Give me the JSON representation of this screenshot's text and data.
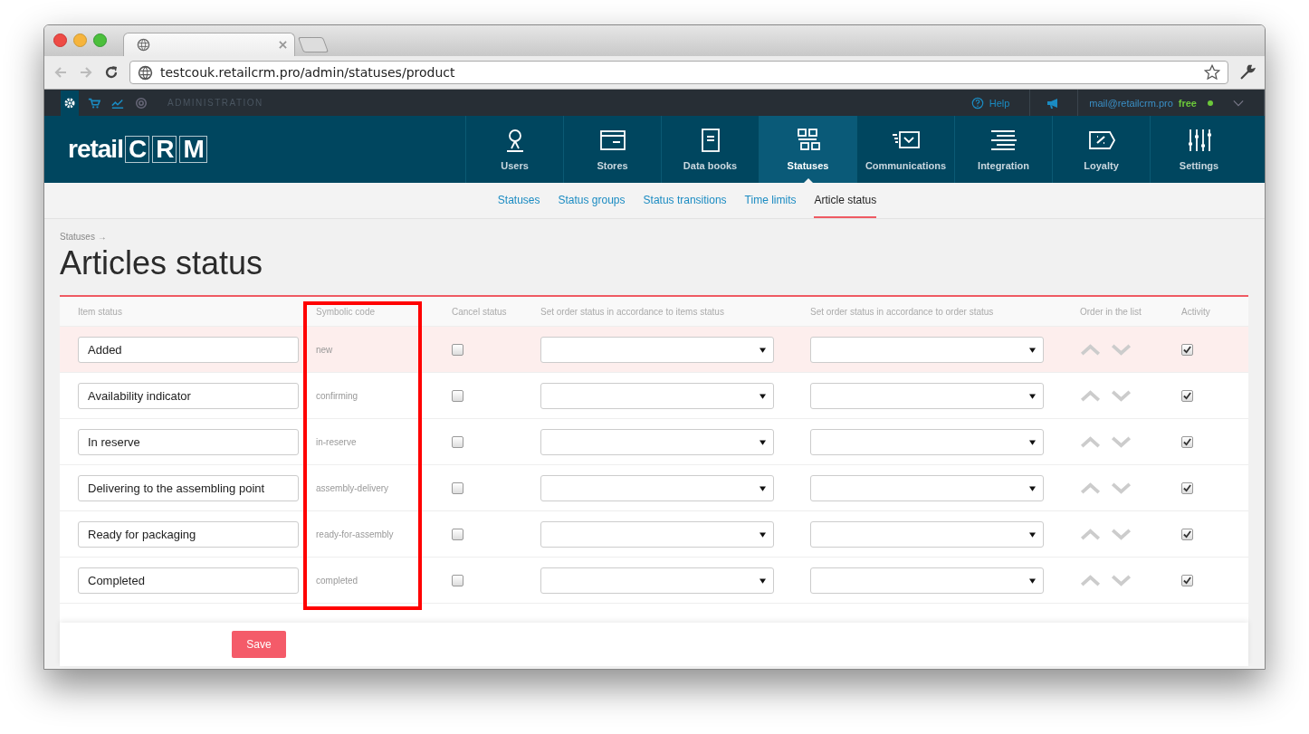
{
  "browser": {
    "url": "testcouk.retailcrm.pro/admin/statuses/product"
  },
  "topbar": {
    "section": "ADMINISTRATION",
    "help": "Help",
    "email": "mail@retailcrm.pro",
    "plan": "free"
  },
  "logo": {
    "prefix": "retail",
    "letters": [
      "C",
      "R",
      "M"
    ]
  },
  "nav": [
    {
      "label": "Users",
      "selected": false
    },
    {
      "label": "Stores",
      "selected": false
    },
    {
      "label": "Data books",
      "selected": false
    },
    {
      "label": "Statuses",
      "selected": true
    },
    {
      "label": "Communications",
      "selected": false
    },
    {
      "label": "Integration",
      "selected": false
    },
    {
      "label": "Loyalty",
      "selected": false
    },
    {
      "label": "Settings",
      "selected": false
    }
  ],
  "subnav": [
    {
      "label": "Statuses",
      "selected": false
    },
    {
      "label": "Status groups",
      "selected": false
    },
    {
      "label": "Status transitions",
      "selected": false
    },
    {
      "label": "Time limits",
      "selected": false
    },
    {
      "label": "Article status",
      "selected": true
    }
  ],
  "breadcrumb": "Statuses →",
  "title": "Articles status",
  "table": {
    "columns": [
      {
        "label": "Item status",
        "highlighted": false
      },
      {
        "label": "Symbolic code",
        "highlighted": true
      },
      {
        "label": "Cancel status",
        "highlighted": false
      },
      {
        "label": "Set order status in accordance to items status",
        "highlighted": false
      },
      {
        "label": "Set order status in accordance to order status",
        "highlighted": false
      },
      {
        "label": "Order in the list",
        "highlighted": false
      },
      {
        "label": "Activity",
        "highlighted": false
      }
    ],
    "rows": [
      {
        "name": "Added",
        "code": "new",
        "cancel": false,
        "active": true,
        "highlighted": true
      },
      {
        "name": "Availability indicator",
        "code": "confirming",
        "cancel": false,
        "active": true,
        "highlighted": false
      },
      {
        "name": "In reserve",
        "code": "in-reserve",
        "cancel": false,
        "active": true,
        "highlighted": false
      },
      {
        "name": "Delivering to the assembling point",
        "code": "assembly-delivery",
        "cancel": false,
        "active": true,
        "highlighted": false
      },
      {
        "name": "Ready for packaging",
        "code": "ready-for-assembly",
        "cancel": false,
        "active": true,
        "highlighted": false
      },
      {
        "name": "Completed",
        "code": "completed",
        "cancel": false,
        "active": true,
        "highlighted": false
      }
    ]
  },
  "save": "Save"
}
